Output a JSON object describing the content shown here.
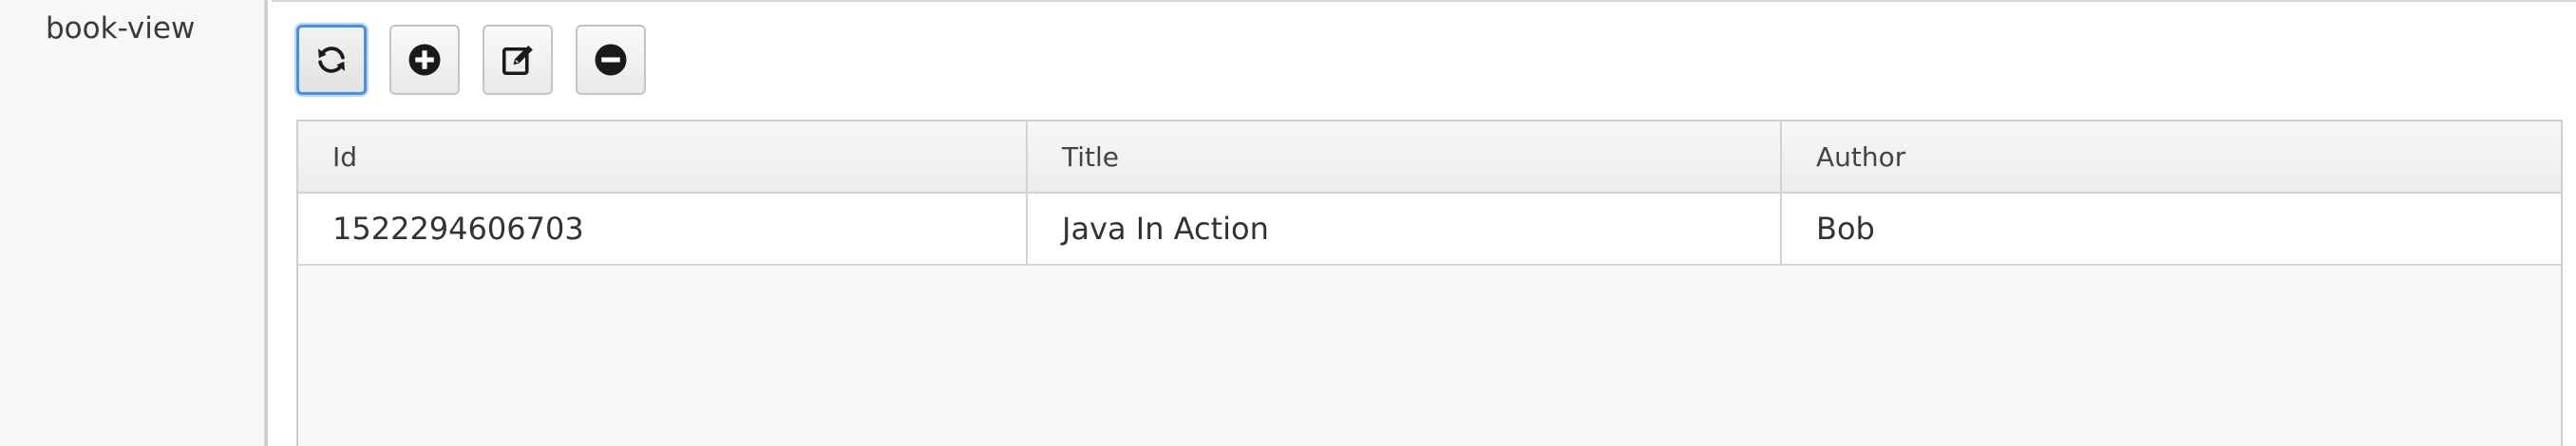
{
  "sidebar": {
    "items": [
      {
        "label": "book-view"
      }
    ]
  },
  "toolbar": {
    "buttons": [
      {
        "name": "refresh",
        "icon": "refresh-icon",
        "active": true
      },
      {
        "name": "add",
        "icon": "plus-circle-icon",
        "active": false
      },
      {
        "name": "edit",
        "icon": "edit-icon",
        "active": false
      },
      {
        "name": "delete",
        "icon": "minus-circle-icon",
        "active": false
      }
    ]
  },
  "grid": {
    "columns": [
      "Id",
      "Title",
      "Author"
    ],
    "rows": [
      {
        "id": "1522294606703",
        "title": "Java In Action",
        "author": "Bob"
      }
    ]
  },
  "colors": {
    "focus_border": "#4a90e2",
    "sidebar_bg": "#f7f7f7",
    "grid_body_bg": "#f9f9f9"
  }
}
